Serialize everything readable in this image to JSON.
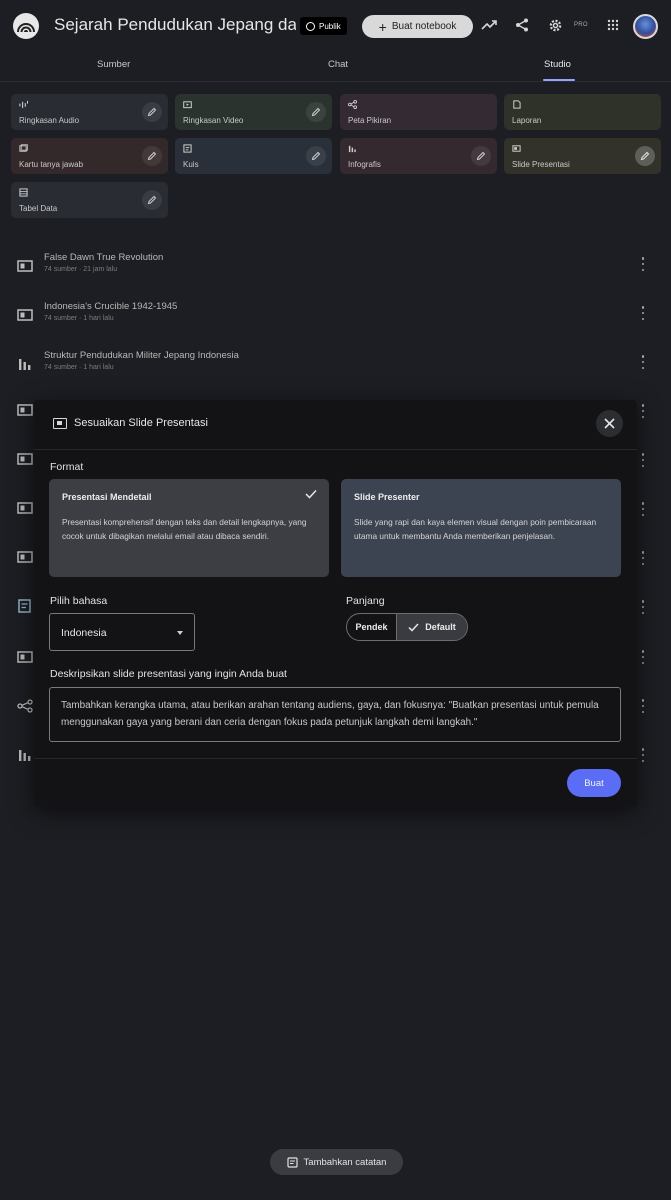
{
  "header": {
    "title": "Sejarah Pendudukan Jepang dan Pe",
    "visibility_label": "Publik",
    "create_notebook_label": "Buat notebook",
    "pro_label": "PRO"
  },
  "tabs": [
    {
      "label": "Sumber"
    },
    {
      "label": "Chat"
    },
    {
      "label": "Studio"
    }
  ],
  "studio_tiles": [
    {
      "label": "Ringkasan Audio",
      "icon": "audio-waveform-icon"
    },
    {
      "label": "Ringkasan Video",
      "icon": "video-icon"
    },
    {
      "label": "Peta Pikiran",
      "icon": "mind-map-icon"
    },
    {
      "label": "Laporan",
      "icon": "report-icon"
    },
    {
      "label": "Kartu tanya jawab",
      "icon": "flashcard-icon"
    },
    {
      "label": "Kuis",
      "icon": "quiz-icon"
    },
    {
      "label": "Infografis",
      "icon": "infographic-icon"
    },
    {
      "label": "Slide Presentasi",
      "icon": "slides-icon"
    },
    {
      "label": "Tabel Data",
      "icon": "table-icon"
    }
  ],
  "list_items": [
    {
      "title": "False Dawn True Revolution",
      "meta": "74 sumber · 21 jam lalu",
      "icon": "slides-icon"
    },
    {
      "title": "Indonesia's Crucible 1942-1945",
      "meta": "74 sumber · 1 hari lalu",
      "icon": "slides-icon"
    },
    {
      "title": "Struktur Pendudukan Militer Jepang Indonesia",
      "meta": "74 sumber · 1 hari lalu",
      "icon": "infographic-icon"
    }
  ],
  "modal": {
    "title": "Sesuaikan Slide Presentasi",
    "format_label": "Format",
    "options": [
      {
        "title": "Presentasi Mendetail",
        "description": "Presentasi komprehensif dengan teks dan detail lengkapnya, yang cocok untuk dibagikan melalui email atau dibaca sendiri.",
        "selected": true
      },
      {
        "title": "Slide Presenter",
        "description": "Slide yang rapi dan kaya elemen visual dengan poin pembicaraan utama untuk membantu Anda memberikan penjelasan.",
        "selected": false
      }
    ],
    "language_label": "Pilih bahasa",
    "language_value": "Indonesia",
    "length_label": "Panjang",
    "length_options": [
      "Pendek",
      "Default"
    ],
    "length_selected": "Default",
    "describe_label": "Deskripsikan slide presentasi yang ingin Anda buat",
    "describe_placeholder": "Tambahkan kerangka utama, atau berikan arahan tentang audiens, gaya, dan fokusnya: \"Buatkan presentasi untuk pemula menggunakan gaya yang berani dan ceria dengan fokus pada petunjuk langkah demi langkah.\"",
    "submit_label": "Buat"
  },
  "add_note_label": "Tambahkan catatan",
  "colors": {
    "accent": "#5b6cf5",
    "background": "#1d1e23",
    "modal_background": "#131316"
  }
}
